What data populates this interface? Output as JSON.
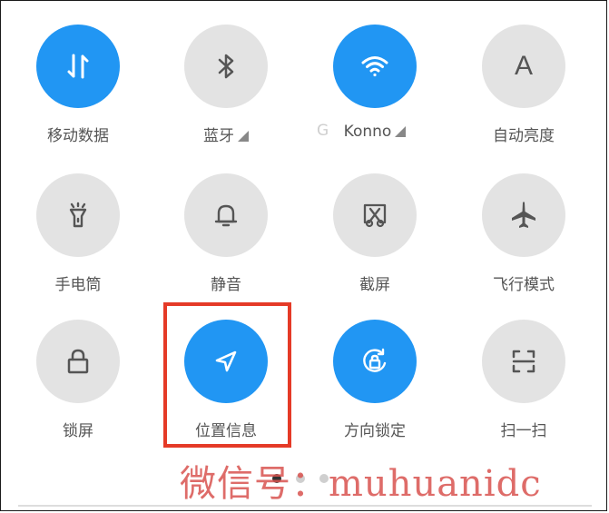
{
  "tiles": [
    {
      "label": "移动数据",
      "icon": "mobile-data-icon",
      "state": "on"
    },
    {
      "label": "蓝牙",
      "icon": "bluetooth-icon",
      "state": "off",
      "has_expand": true
    },
    {
      "label": "Konno",
      "icon": "wifi-icon",
      "state": "on",
      "has_expand": true
    },
    {
      "label": "自动亮度",
      "icon": "auto-brightness-icon",
      "state": "off",
      "icon_text": "A"
    },
    {
      "label": "手电筒",
      "icon": "flashlight-icon",
      "state": "off"
    },
    {
      "label": "静音",
      "icon": "bell-icon",
      "state": "off"
    },
    {
      "label": "截屏",
      "icon": "screenshot-icon",
      "state": "off"
    },
    {
      "label": "飞行模式",
      "icon": "airplane-icon",
      "state": "off"
    },
    {
      "label": "锁屏",
      "icon": "lock-icon",
      "state": "off"
    },
    {
      "label": "位置信息",
      "icon": "location-icon",
      "state": "on"
    },
    {
      "label": "方向锁定",
      "icon": "rotation-lock-icon",
      "state": "on"
    },
    {
      "label": "扫一扫",
      "icon": "scan-icon",
      "state": "off"
    }
  ],
  "ghost_text": "G",
  "watermark": "微信号：muhuanidc",
  "colors": {
    "on": "#2196f3",
    "off": "#e3e3e3",
    "highlight": "#e53a27",
    "watermark": "#d9534f"
  }
}
